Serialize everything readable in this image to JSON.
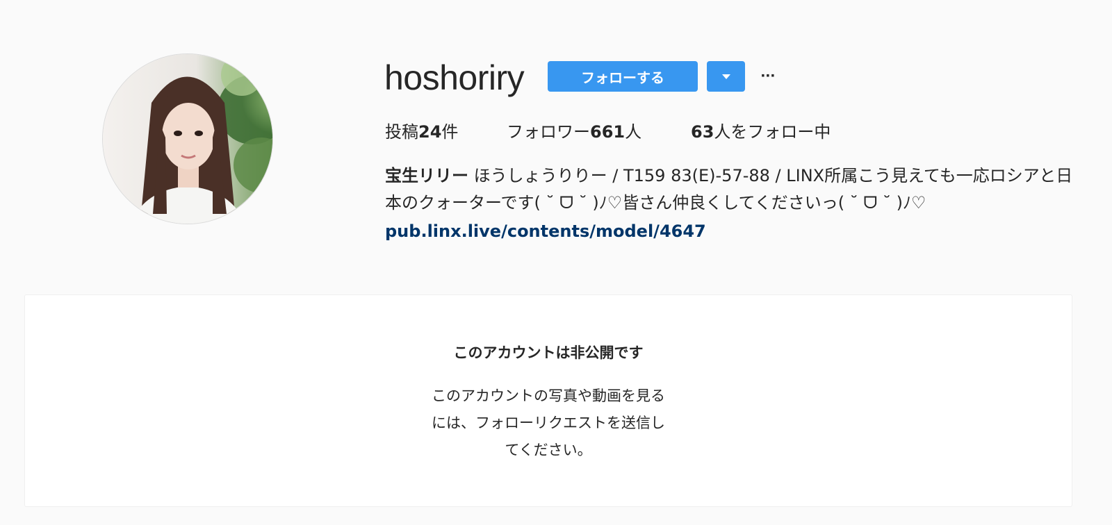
{
  "profile": {
    "username": "hoshoriry",
    "avatar_alt": "profile photo",
    "follow_label": "フォローする",
    "dropdown_icon": "caret-down-icon",
    "more_label": "···"
  },
  "stats": {
    "posts_prefix": "投稿",
    "posts_count": "24",
    "posts_suffix": "件",
    "followers_prefix": "フォロワー",
    "followers_count": "661",
    "followers_suffix": "人",
    "following_count": "63",
    "following_suffix": "人をフォロー中"
  },
  "bio": {
    "full_name": "宝生リリー",
    "text": "ほうしょうりりー / T159 83(E)-57-88 / LINX所属こう見えても一応ロシアと日本のクォーターです( ˘ ᗜ ˘ )ﾉ♡皆さん仲良くしてくださいっ( ˘ ᗜ ˘ )ﾉ♡",
    "link": "pub.linx.live/contents/model/4647"
  },
  "private_notice": {
    "title": "このアカウントは非公開です",
    "line1": "このアカウントの写真や動画を見る",
    "line2": "には、フォローリクエストを送信し",
    "line3": "てください。"
  },
  "colors": {
    "accent": "#3897f0",
    "link": "#003569",
    "background": "#fafafa",
    "card": "#ffffff"
  }
}
